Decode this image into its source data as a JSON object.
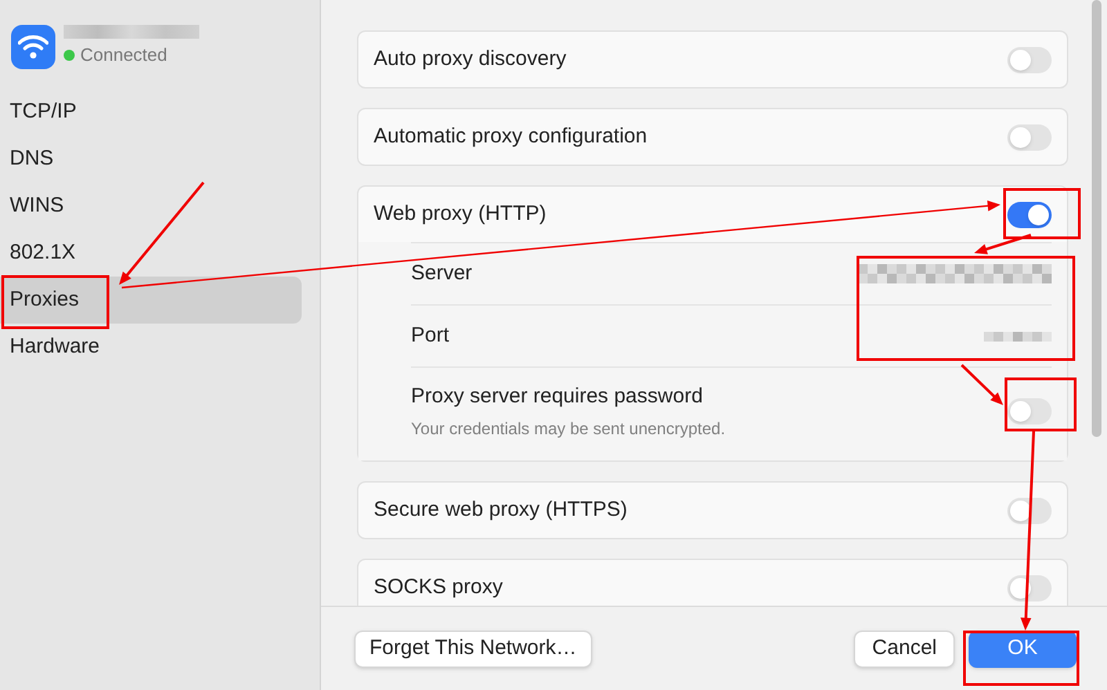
{
  "network": {
    "status": "Connected"
  },
  "sidebar": {
    "items": [
      {
        "label": "TCP/IP",
        "selected": false
      },
      {
        "label": "DNS",
        "selected": false
      },
      {
        "label": "WINS",
        "selected": false
      },
      {
        "label": "802.1X",
        "selected": false
      },
      {
        "label": "Proxies",
        "selected": true
      },
      {
        "label": "Hardware",
        "selected": false
      }
    ]
  },
  "proxies": [
    {
      "label": "Auto proxy discovery",
      "on": false
    },
    {
      "label": "Automatic proxy configuration",
      "on": false
    },
    {
      "label": "Web proxy (HTTP)",
      "on": true,
      "details": [
        {
          "kind": "value",
          "label": "Server"
        },
        {
          "kind": "value",
          "label": "Port"
        },
        {
          "kind": "toggle",
          "label": "Proxy server requires password",
          "note": "Your credentials may be sent unencrypted.",
          "on": false
        }
      ]
    },
    {
      "label": "Secure web proxy (HTTPS)",
      "on": false
    },
    {
      "label": "SOCKS proxy",
      "on": false
    }
  ],
  "buttons": [
    {
      "label": "Forget This Network…",
      "kind": "secondary"
    },
    {
      "label": "Cancel",
      "kind": "secondary"
    },
    {
      "label": "OK",
      "kind": "primary"
    }
  ]
}
